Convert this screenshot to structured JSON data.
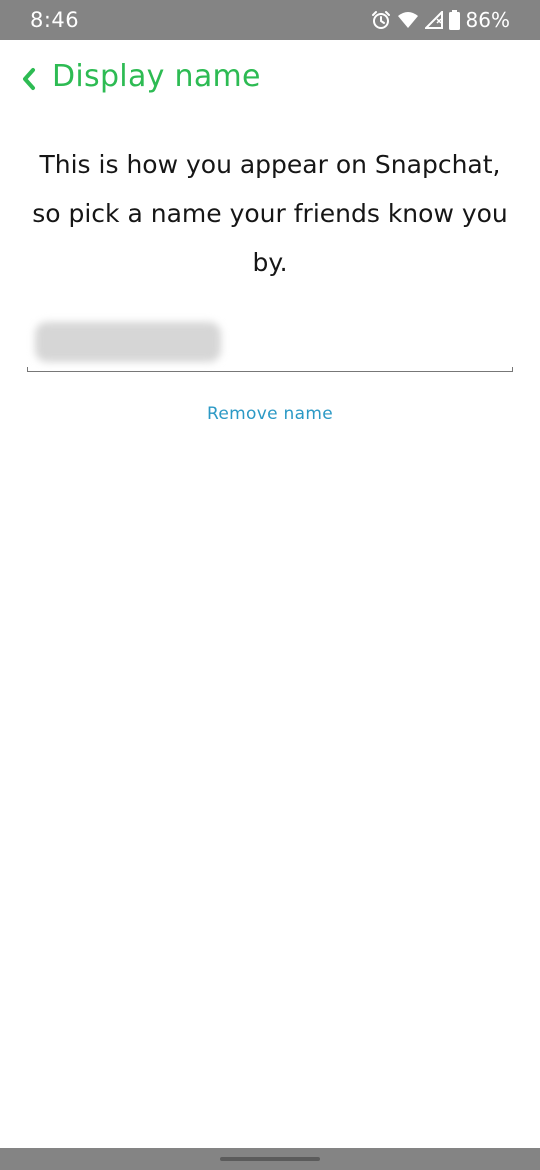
{
  "status_bar": {
    "time": "8:46",
    "battery_percent": "86%",
    "icons": [
      "alarm-icon",
      "wifi-icon",
      "cell-signal-icon",
      "battery-icon"
    ]
  },
  "header": {
    "back_icon": "chevron-left-icon",
    "title": "Display name",
    "accent_color": "#2dbb53"
  },
  "main": {
    "description_line_1": "This is how you appear on Snapchat,",
    "description_line_2": "so pick a name your friends know you",
    "description_line_3": "by.",
    "name_field": {
      "value_obscured": true
    },
    "remove_label": "Remove name",
    "link_color": "#2b99c5"
  },
  "nav_bar": {
    "handle": "home-gesture-pill"
  }
}
